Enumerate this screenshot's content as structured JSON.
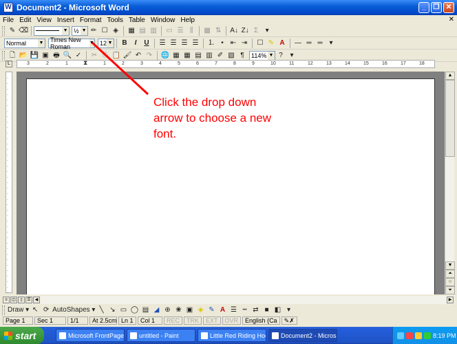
{
  "window": {
    "title": "Document2 - Microsoft Word",
    "app_icon": "W"
  },
  "menu": [
    "File",
    "Edit",
    "View",
    "Insert",
    "Format",
    "Tools",
    "Table",
    "Window",
    "Help"
  ],
  "toolbar_top": {
    "line_weight": "½"
  },
  "formatting": {
    "style": "Normal",
    "font": "Times New Roman",
    "size": "12",
    "bold": "B",
    "italic": "I",
    "underline": "U"
  },
  "standard": {
    "zoom": "114%"
  },
  "ruler_numbers": [
    "3",
    "2",
    "1",
    "1",
    "2",
    "3",
    "4",
    "5",
    "6",
    "7",
    "8",
    "9",
    "10",
    "11",
    "12",
    "13",
    "14",
    "15",
    "16",
    "17",
    "18"
  ],
  "annotation": {
    "text": "Click the drop down arrow to choose a new font.",
    "color": "#ff0000"
  },
  "drawing": {
    "draw_label": "Draw",
    "autoshapes_label": "AutoShapes"
  },
  "status": {
    "page": "Page 1",
    "sec": "Sec 1",
    "pages": "1/1",
    "at": "At 2.5cm",
    "ln": "Ln 1",
    "col": "Col 1",
    "rec": "REC",
    "trk": "TRK",
    "ext": "EXT",
    "ovr": "OVR",
    "lang": "English (Ca"
  },
  "taskbar": {
    "start": "start",
    "tasks": [
      "Microsoft FrontPage -...",
      "untitled - Paint",
      "Little Red Riding Hoo...",
      "Document2 - Microsof..."
    ],
    "clock": "8:19 PM"
  }
}
